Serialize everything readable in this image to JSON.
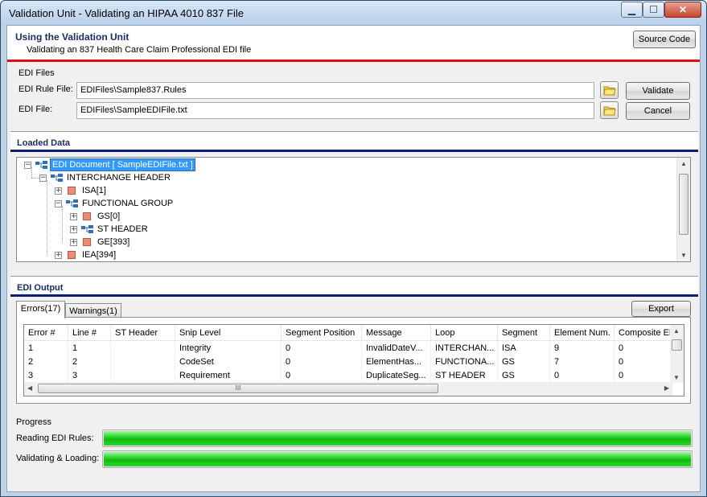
{
  "window": {
    "title": "Validation Unit - Validating an HIPAA 4010 837 File",
    "minimize_glyph": "▁",
    "maximize_glyph": "☐",
    "close_glyph": "✕"
  },
  "header": {
    "title": "Using the Validation Unit",
    "subtitle": "Validating an 837 Health Care Claim Professional EDI file",
    "source_code_label": "Source Code"
  },
  "edi_files": {
    "group_label": "EDI Files",
    "rule_file_label": "EDI Rule File:",
    "rule_file_value": "EDIFiles\\Sample837.Rules",
    "edi_file_label": "EDI File:",
    "edi_file_value": "EDIFiles\\SampleEDIFile.txt",
    "validate_label": "Validate",
    "cancel_label": "Cancel"
  },
  "loaded_data": {
    "title": "Loaded Data",
    "tree": [
      {
        "label": "EDI Document [ SampleEDIFile.txt ]",
        "icon": "tree-node-icon",
        "expander": "−",
        "selected": true
      },
      {
        "label": "INTERCHANGE HEADER",
        "icon": "tree-node-icon",
        "expander": "−"
      },
      {
        "label": "ISA[1]",
        "icon": "segment-icon",
        "expander": "+"
      },
      {
        "label": "FUNCTIONAL GROUP",
        "icon": "tree-node-icon",
        "expander": "−"
      },
      {
        "label": "GS[0]",
        "icon": "segment-icon",
        "expander": "+"
      },
      {
        "label": "ST HEADER",
        "icon": "tree-node-icon",
        "expander": "+"
      },
      {
        "label": "GE[393]",
        "icon": "segment-icon",
        "expander": "+"
      },
      {
        "label": "IEA[394]",
        "icon": "segment-icon",
        "expander": "+"
      }
    ]
  },
  "edi_output": {
    "title": "EDI Output",
    "tabs": [
      {
        "label": "Errors(17)",
        "active": true
      },
      {
        "label": "Warnings(1)",
        "active": false
      }
    ],
    "export_label": "Export",
    "columns": [
      "Error #",
      "Line #",
      "ST Header",
      "Snip Level",
      "Segment Position",
      "Message",
      "Loop",
      "Segment",
      "Element Num.",
      "Composite Ele"
    ],
    "rows": [
      [
        "1",
        "1",
        "",
        "Integrity",
        "0",
        "InvalidDateV...",
        "INTERCHAN...",
        "ISA",
        "9",
        "0"
      ],
      [
        "2",
        "2",
        "",
        "CodeSet",
        "0",
        "ElementHas...",
        "FUNCTIONA...",
        "GS",
        "7",
        "0"
      ],
      [
        "3",
        "3",
        "",
        "Requirement",
        "0",
        "DuplicateSeg...",
        "ST HEADER",
        "GS",
        "0",
        "0"
      ]
    ],
    "hscroll_grip": "III"
  },
  "progress": {
    "group_label": "Progress",
    "items": [
      {
        "label": "Reading EDI Rules:",
        "value": 1.0
      },
      {
        "label": "Validating & Loading:",
        "value": 1.0
      }
    ]
  },
  "colors": {
    "accent_red": "#e01010",
    "section_bar": "#0b1d7a",
    "progress_green": "#0fbb0f",
    "selection_blue": "#3399ff"
  }
}
